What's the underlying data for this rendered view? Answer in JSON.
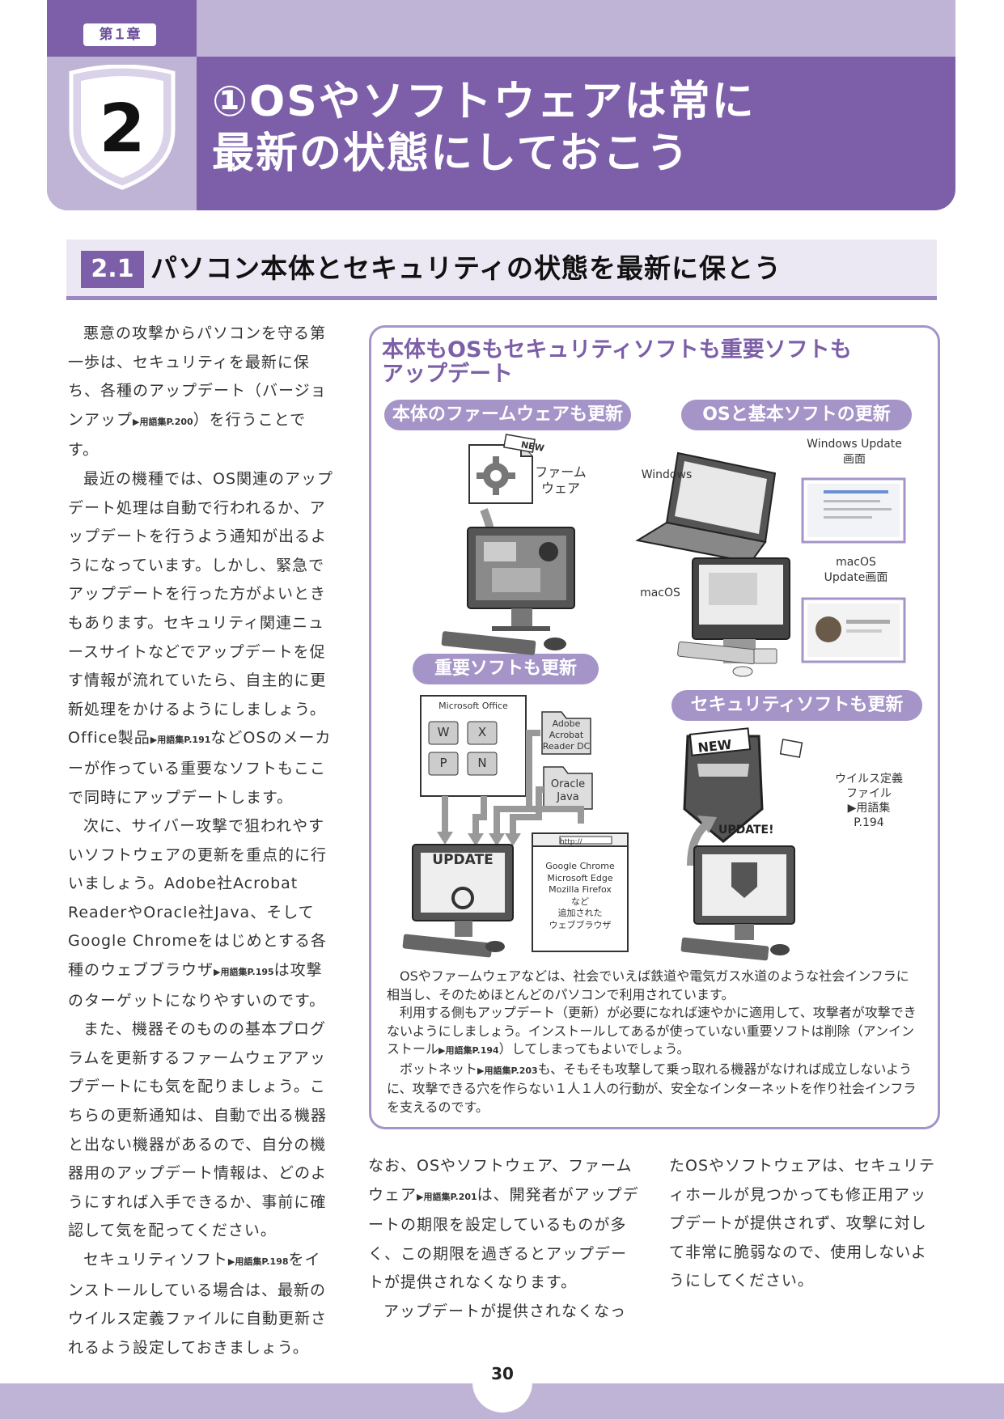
{
  "header": {
    "chapter_tag": "第１章",
    "chapter_number": "2",
    "title_line1": "①OSやソフトウェアは常に",
    "title_line2": "最新の状態にしておこう"
  },
  "section": {
    "number": "2.1",
    "title": "パソコン本体とセキュリティの状態を最新に保とう"
  },
  "left_column": [
    [
      "悪意の攻撃からパソコンを守る第一歩は、セキュリティを最新に保ち、各種のアップデート（バージョンアップ",
      "▶用語集P.200",
      "）を行うことです。"
    ],
    [
      "最近の機種では、OS関連のアップデート処理は自動で行われるか、アップデートを行うよう通知が出るようになっています。しかし、緊急でアップデートを行った方がよいときもあります。セキュリティ関連ニュースサイトなどでアップデートを促す情報が流れていたら、自主的に更新処理をかけるようにしましょう。Office製品",
      "▶用語集P.191",
      "などOSのメーカーが作っている重要なソフトもここで同時にアップデートします。"
    ],
    [
      "次に、サイバー攻撃で狙われやすいソフトウェアの更新を重点的に行いましょう。Adobe社Acrobat ReaderやOracle社Java、そしてGoogle Chromeをはじめとする各種のウェブブラウザ",
      "▶用語集P.195",
      "は攻撃のターゲットになりやすいのです。"
    ],
    [
      "また、機器そのものの基本プログラムを更新するファームウェアアップデートにも気を配りましょう。こちらの更新通知は、自動で出る機器と出ない機器があるので、自分の機器用のアップデート情報は、どのようにすれば入手できるか、事前に確認して気を配ってください。"
    ],
    [
      "セキュリティソフト",
      "▶用語集P.198",
      "をインストールしている場合は、最新のウイルス定義ファイルに自動更新されるよう設定しておきましょう。"
    ]
  ],
  "box": {
    "title_line1": "本体もOSもセキュリティソフトも重要ソフトも",
    "title_line2": "アップデート",
    "pill_firmware": "本体のファームウェアも更新",
    "pill_os": "OSと基本ソフトの更新",
    "pill_software": "重要ソフトも更新",
    "pill_security": "セキュリティソフトも更新",
    "new_badge": "NEW",
    "firmware_label_1": "ファーム",
    "firmware_label_2": "ウェア",
    "windows_label": "Windows",
    "windows_update_1": "Windows Update",
    "windows_update_2": "画面",
    "macos_label": "macOS",
    "macos_update_1": "macOS",
    "macos_update_2": "Update画面",
    "ms_office": "Microsoft Office",
    "office_apps": [
      "W",
      "X",
      "P",
      "N"
    ],
    "adobe_1": "Adobe",
    "adobe_2": "Acrobat",
    "adobe_3": "Reader DC",
    "oracle_1": "Oracle",
    "oracle_2": "Java",
    "update_screen": "UPDATE",
    "browser_url": "http://",
    "browsers": [
      "Google Chrome",
      "Microsoft Edge",
      "Mozilla Firefox",
      "など",
      "追加された",
      "ウェブブラウザ"
    ],
    "shield_new": "NEW",
    "shield_update": "UPDATE!",
    "virus_def": [
      "ウイルス定義",
      "ファイル",
      "▶用語集",
      "P.194"
    ],
    "text": [
      [
        "OSやファームウェアなどは、社会でいえば鉄道や電気ガス水道のような社会インフラに相当し、そのためほとんどのパソコンで利用されています。"
      ],
      [
        "利用する側もアップデート（更新）が必要になれば速やかに適用して、攻撃者が攻撃できないようにしましょう。インストールしてあるが使っていない重要ソフトは削除（アンインストール",
        "▶用語集P.194",
        "）してしまってもよいでしょう。"
      ],
      [
        "ボットネット",
        "▶用語集P.203",
        "も、そもそも攻撃して乗っ取れる機器がなければ成立しないように、攻撃できる穴を作らない１人１人の行動が、安全なインターネットを作り社会インフラを支えるのです。"
      ]
    ]
  },
  "mid_column": [
    [
      "なお、OSやソフトウェア、ファームウェア",
      "▶用語集P.201",
      "は、開発者がアップデートの期限を設定しているものが多く、この期限を過ぎるとアップデートが提供されなくなります。"
    ],
    [
      "アップデートが提供されなくなっ"
    ]
  ],
  "right_column": [
    [
      "たOSやソフトウェアは、セキュリティホールが見つかっても修正用アップデートが提供されず、攻撃に対して非常に脆弱なので、使用しないようにしてください。"
    ]
  ],
  "footer": {
    "page_number": "30"
  },
  "colors": {
    "purple": "#7c5fa8",
    "lavender": "#bfb4d6",
    "box_border": "#a594c8"
  }
}
